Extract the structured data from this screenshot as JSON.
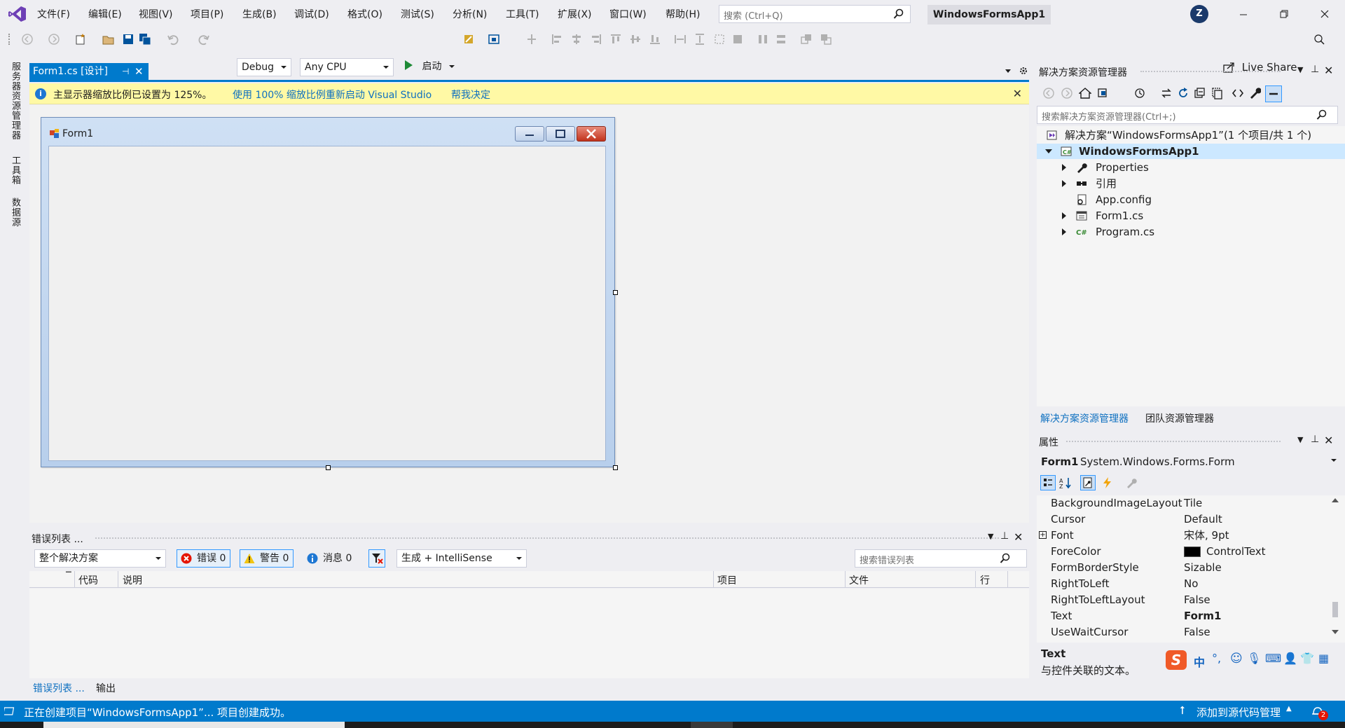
{
  "menu": {
    "items": [
      "文件(F)",
      "编辑(E)",
      "视图(V)",
      "项目(P)",
      "生成(B)",
      "调试(D)",
      "格式(O)",
      "测试(S)",
      "分析(N)",
      "工具(T)",
      "扩展(X)",
      "窗口(W)",
      "帮助(H)"
    ],
    "search_placeholder": "搜索 (Ctrl+Q)",
    "app_title": "WindowsFormsApp1",
    "avatar_initial": "Z"
  },
  "toolbar": {
    "config": "Debug",
    "platform": "Any CPU",
    "start_label": "启动",
    "live_share": "Live Share"
  },
  "left_rail": {
    "tabs": [
      "服务器资源管理器",
      "工具箱",
      "数据源"
    ]
  },
  "document": {
    "tab_title": "Form1.cs [设计]",
    "info_message": "主显示器缩放比例已设置为 125%。",
    "info_link_restart": "使用 100% 缩放比例重新启动 Visual Studio",
    "info_link_help": "帮我决定",
    "form_title": "Form1"
  },
  "error_list": {
    "title": "错误列表 ...",
    "scope": "整个解决方案",
    "errors": "错误 0",
    "warnings": "警告 0",
    "messages": "消息 0",
    "build_filter": "生成 + IntelliSense",
    "search_placeholder": "搜索错误列表",
    "columns": [
      "代码",
      "说明",
      "项目",
      "文件",
      "行"
    ],
    "bottom_tabs": [
      "错误列表 ...",
      "输出"
    ]
  },
  "solution_explorer": {
    "title": "解决方案资源管理器",
    "search_placeholder": "搜索解决方案资源管理器(Ctrl+;)",
    "tree": [
      {
        "label": "解决方案“WindowsFormsApp1”(1 个项目/共 1 个)",
        "icon": "solution-icon"
      },
      {
        "label": "WindowsFormsApp1",
        "icon": "csharp-project-icon"
      },
      {
        "label": "Properties",
        "icon": "wrench-icon"
      },
      {
        "label": "引用",
        "icon": "references-icon"
      },
      {
        "label": "App.config",
        "icon": "config-file-icon"
      },
      {
        "label": "Form1.cs",
        "icon": "form-icon"
      },
      {
        "label": "Program.cs",
        "icon": "csharp-file-icon"
      }
    ],
    "bottom_tabs": [
      "解决方案资源管理器",
      "团队资源管理器"
    ]
  },
  "properties": {
    "title": "属性",
    "object_name": "Form1",
    "object_type": "System.Windows.Forms.Form",
    "rows": [
      {
        "name": "BackgroundImageLayout",
        "value": "Tile"
      },
      {
        "name": "Cursor",
        "value": "Default"
      },
      {
        "name": "Font",
        "value": "宋体, 9pt"
      },
      {
        "name": "ForeColor",
        "value": "ControlText"
      },
      {
        "name": "FormBorderStyle",
        "value": "Sizable"
      },
      {
        "name": "RightToLeft",
        "value": "No"
      },
      {
        "name": "RightToLeftLayout",
        "value": "False"
      },
      {
        "name": "Text",
        "value": "Form1"
      },
      {
        "name": "UseWaitCursor",
        "value": "False"
      }
    ],
    "desc_title": "Text",
    "desc_text": "与控件关联的文本。",
    "forecolor_swatch": "#000000"
  },
  "ime": {
    "logo": "S",
    "mode": "中",
    "punct": "°,"
  },
  "status": {
    "message": "正在创建项目“WindowsFormsApp1”... 项目创建成功。",
    "source_control": "添加到源代码管理",
    "notifications": "2"
  },
  "colors": {
    "accent": "#007acc",
    "info_bar": "#fff9a5",
    "selection": "#cce8ff"
  }
}
